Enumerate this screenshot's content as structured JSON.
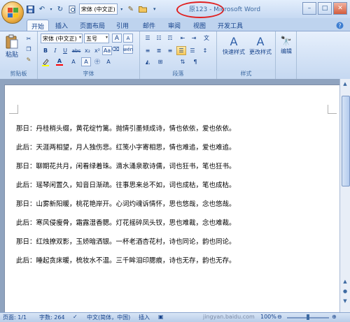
{
  "title_bar": {
    "doc_name": "原123",
    "app_name": "Microsoft Word",
    "qat_font": "宋体 (中文正)"
  },
  "tabs": [
    "开始",
    "插入",
    "页面布局",
    "引用",
    "邮件",
    "审阅",
    "视图",
    "开发工具"
  ],
  "ribbon": {
    "clipboard": {
      "paste_label": "粘贴",
      "group_label": "剪贴板"
    },
    "font": {
      "font_name": "宋体 (中文正)",
      "font_size": "五号",
      "wen_button": "wén",
      "group_label": "字体"
    },
    "paragraph": {
      "group_label": "段落"
    },
    "styles": {
      "quick_styles_label": "快速样式",
      "change_styles_label": "更改样式",
      "group_label": "样式"
    },
    "editing": {
      "label": "编辑"
    }
  },
  "document": {
    "lines": [
      "那日：丹桂梢头缀，黄花绽竹篱。抛情引墨倾成诗，情也依依，爱也依依。",
      "此后：天涯两相望，月人独伤悲。红笺小字寄相思，情也难追，爱也难追。",
      "那日：聊期花共月，闲看绿着珠。滴水涌泉歌诗儒，词也狂书，笔也狂书。",
      "此后：瑶琴闲置久，知音日渐疏。往事思来总不如，词也成枯，笔也成枯。",
      "那日：山雾新阳暖，桃花艳岸开。心词灼魂诉情怀，思也悠哉，念也悠哉。",
      "此后：寒风侵瘦骨，霜露湿香腮。灯花摇碎凤头钗，思也难裁，念也难裁。",
      "那日：红烛撩双影，玉娇暗洒银。一杯老酒杏花村，诗也同论，韵也同论。",
      "此后：睡起贪床暖，梳妆水不温。三千眸泪印腮痕，诗也无存，韵也无存。"
    ]
  },
  "status_bar": {
    "page": "页面: 1/1",
    "words": "字数: 264",
    "language": "中文(简体，中国)",
    "mode": "插入",
    "zoom": "100%",
    "watermark": "jingyan.baidu.com"
  },
  "colors": {
    "highlight": "#ffff00",
    "font_color": "#ff0000",
    "title_circle": "#e02020"
  }
}
